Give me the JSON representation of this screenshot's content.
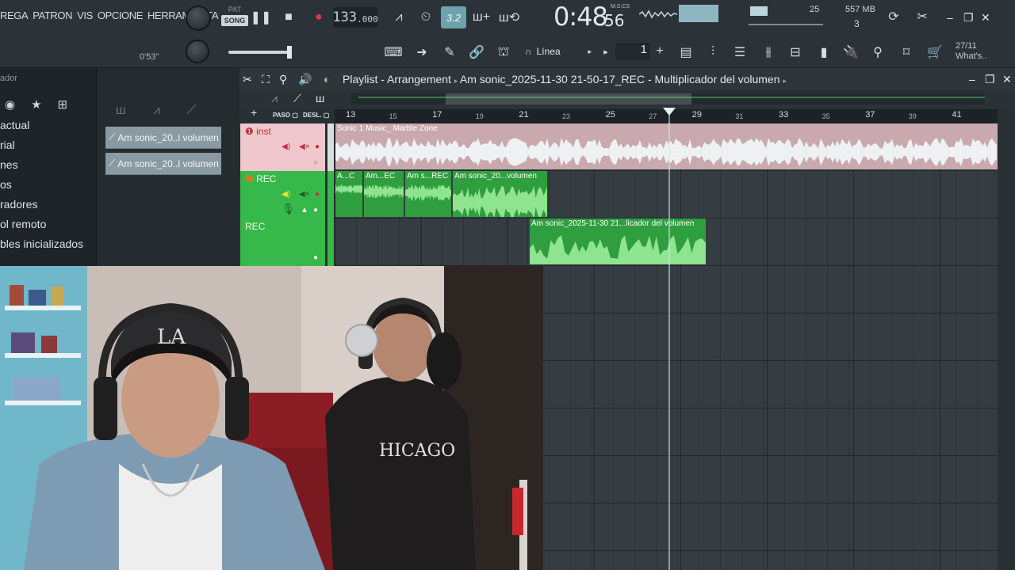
{
  "toolbar": {
    "menu": [
      "REGA",
      "PATRON",
      "VIS",
      "OPCIONE",
      "HERRAMIENTA"
    ],
    "pat_label": "PAT",
    "song_label": "SONG",
    "tempo_int": "133",
    "tempo_dec": ".000",
    "time_main": "0:48",
    "time_cs": "56",
    "time_label": "M:S:CS",
    "elapsed": "0'53''",
    "cpu": "25",
    "memory": "557 MB",
    "polyphony": "3",
    "snap_label": "Línea",
    "step_value": "1",
    "hint_line1": "27/11",
    "hint_line2": "What's..",
    "pattern_counter": "3.2"
  },
  "browser": {
    "title": "ador",
    "items": [
      "actual",
      "rial",
      "nes",
      "os",
      "radores",
      "ol remoto",
      "bles inicializados"
    ]
  },
  "picker": {
    "clips": [
      "Am sonic_20..l volumen",
      "Am sonic_20..l volumen"
    ]
  },
  "playlist": {
    "title": "Playlist - Arrangement",
    "breadcrumb": "Am sonic_2025-11-30 21-50-17_REC - Multiplicador del volumen",
    "paso_label": "PASO",
    "desl_label": "DESL.",
    "ruler": [
      {
        "label": "13",
        "major": true
      },
      {
        "label": "15",
        "major": false
      },
      {
        "label": "17",
        "major": true
      },
      {
        "label": "19",
        "major": false
      },
      {
        "label": "21",
        "major": true
      },
      {
        "label": "23",
        "major": false
      },
      {
        "label": "25",
        "major": true
      },
      {
        "label": "27",
        "major": false
      },
      {
        "label": "29",
        "major": true
      },
      {
        "label": "31",
        "major": false
      },
      {
        "label": "33",
        "major": true
      },
      {
        "label": "35",
        "major": false
      },
      {
        "label": "37",
        "major": true
      },
      {
        "label": "39",
        "major": false
      },
      {
        "label": "41",
        "major": true
      }
    ],
    "tracks": [
      {
        "name": "inst",
        "color": "#f0c7cc"
      },
      {
        "name": "REC",
        "color": "#36b84a"
      },
      {
        "name": "REC",
        "color": "#36b84a"
      }
    ],
    "clips": {
      "inst": "Sonic 1 Music_ Marble Zone",
      "rec1": [
        "A...C",
        "Am...EC",
        "Am s...REC",
        "Am sonic_20...volumen"
      ],
      "rec2": "Am sonic_2025-11-30 21...licador del volumen"
    }
  },
  "colors": {
    "toolbar_bg": "#2b3338",
    "playlist_bg": "#353d42",
    "rec_clip": "#2f9e3f",
    "inst_clip": "#c9a9ae",
    "accent_green": "#66d36e"
  }
}
